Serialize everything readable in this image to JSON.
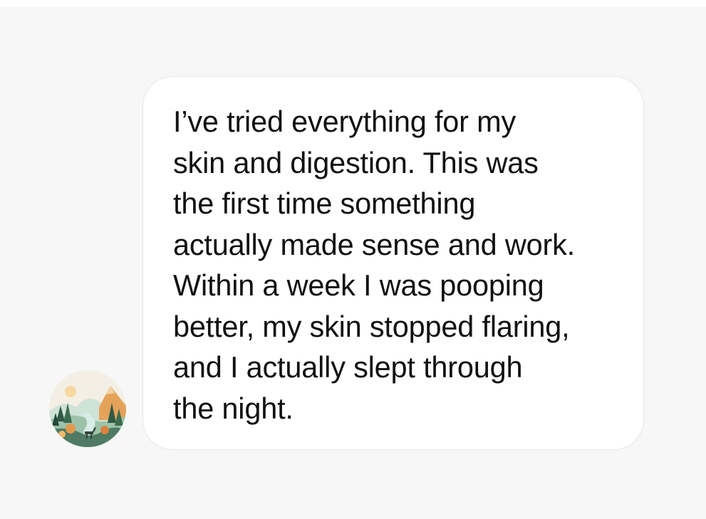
{
  "conversation": {
    "sender": {
      "avatar_icon": "forest-landscape-avatar"
    },
    "message": {
      "lines": [
        "I’ve tried everything for my",
        "skin and digestion. This was",
        "the first time something",
        "actually made sense and work.",
        "Within a week I was pooping",
        "better, my skin stopped flaring,",
        "and I actually slept through",
        "the night."
      ]
    }
  },
  "colors": {
    "background": "#f7f7f7",
    "bubble": "#ffffff",
    "text": "#111111"
  }
}
